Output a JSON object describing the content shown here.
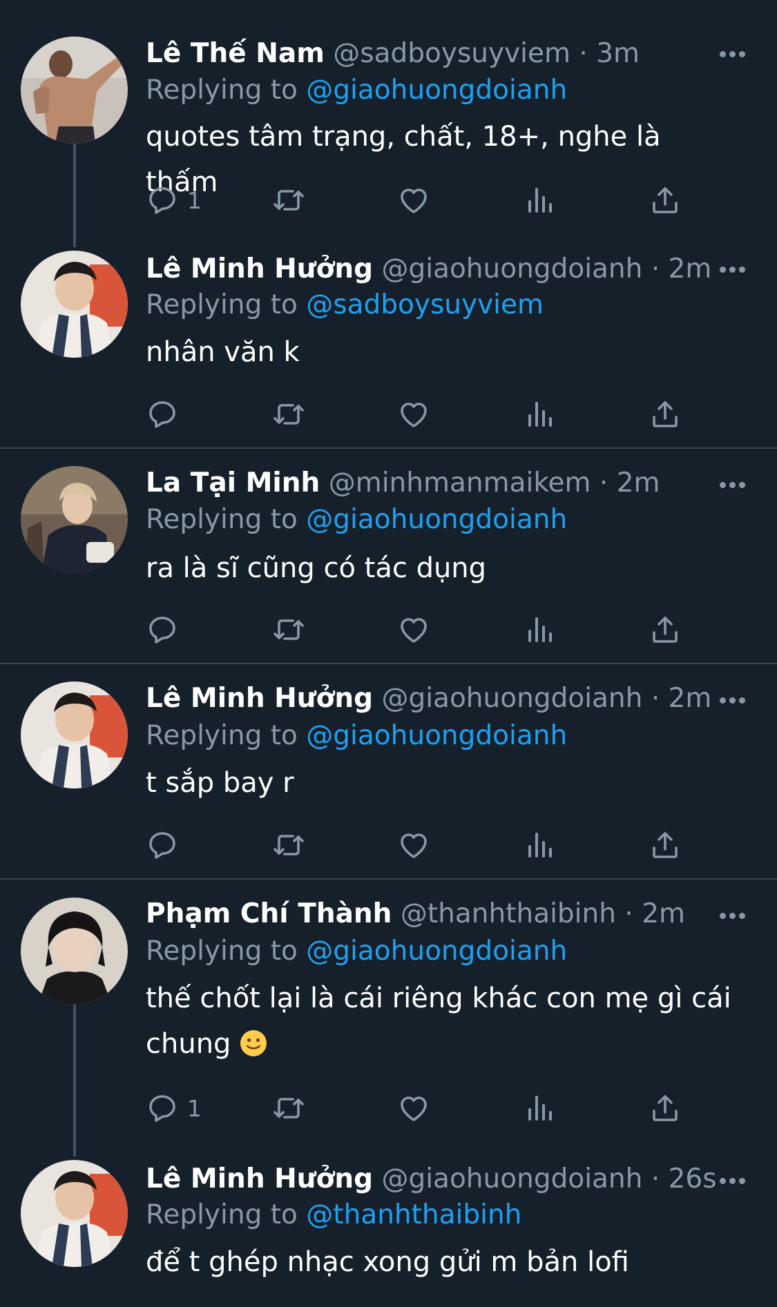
{
  "colors": {
    "background": "#15202b",
    "divider": "#38444d",
    "secondary_text": "#8899a6",
    "link": "#1da1f2",
    "primary_text": "#ffffff"
  },
  "tweets": [
    {
      "name": "Lê Thế Nam",
      "handle": "@sadboysuyviem",
      "time": "3m",
      "reply_prefix": "Replying to",
      "reply_to": "@giaohuongdoianh",
      "text": "quotes tâm trạng, chất, 18+, nghe là thấm",
      "reply_count": "1"
    },
    {
      "name": "Lê Minh Hưởng",
      "handle": "@giaohuongdoianh",
      "time": "2m",
      "reply_prefix": "Replying to",
      "reply_to": "@sadboysuyviem",
      "text": "nhân văn k",
      "reply_count": ""
    },
    {
      "name": "La Tại Minh",
      "handle": "@minhmanmaikem",
      "time": "2m",
      "reply_prefix": "Replying to",
      "reply_to": "@giaohuongdoianh",
      "text": "ra là sĩ cũng có tác dụng",
      "reply_count": ""
    },
    {
      "name": "Lê Minh Hưởng",
      "handle": "@giaohuongdoianh",
      "time": "2m",
      "reply_prefix": "Replying to",
      "reply_to": "@giaohuongdoianh",
      "text": "t sắp bay r",
      "reply_count": ""
    },
    {
      "name": "Phạm Chí Thành",
      "handle": "@thanhthaibinh",
      "time": "2m",
      "reply_prefix": "Replying to",
      "reply_to": "@giaohuongdoianh",
      "text": "thế chốt lại là cái riêng khác con mẹ gì cái chung",
      "reply_count": "1"
    },
    {
      "name": "Lê Minh Hưởng",
      "handle": "@giaohuongdoianh",
      "time": "26s",
      "reply_prefix": "Replying to",
      "reply_to": "@thanhthaibinh",
      "text": "để t ghép nhạc xong gửi m bản lofi",
      "reply_count": ""
    }
  ],
  "icons": {
    "reply": "reply-icon",
    "retweet": "retweet-icon",
    "like": "like-icon",
    "analytics": "analytics-icon",
    "share": "share-icon",
    "more": "more-icon",
    "emoji": "slightly-smiling-face-emoji"
  },
  "separator": "·"
}
